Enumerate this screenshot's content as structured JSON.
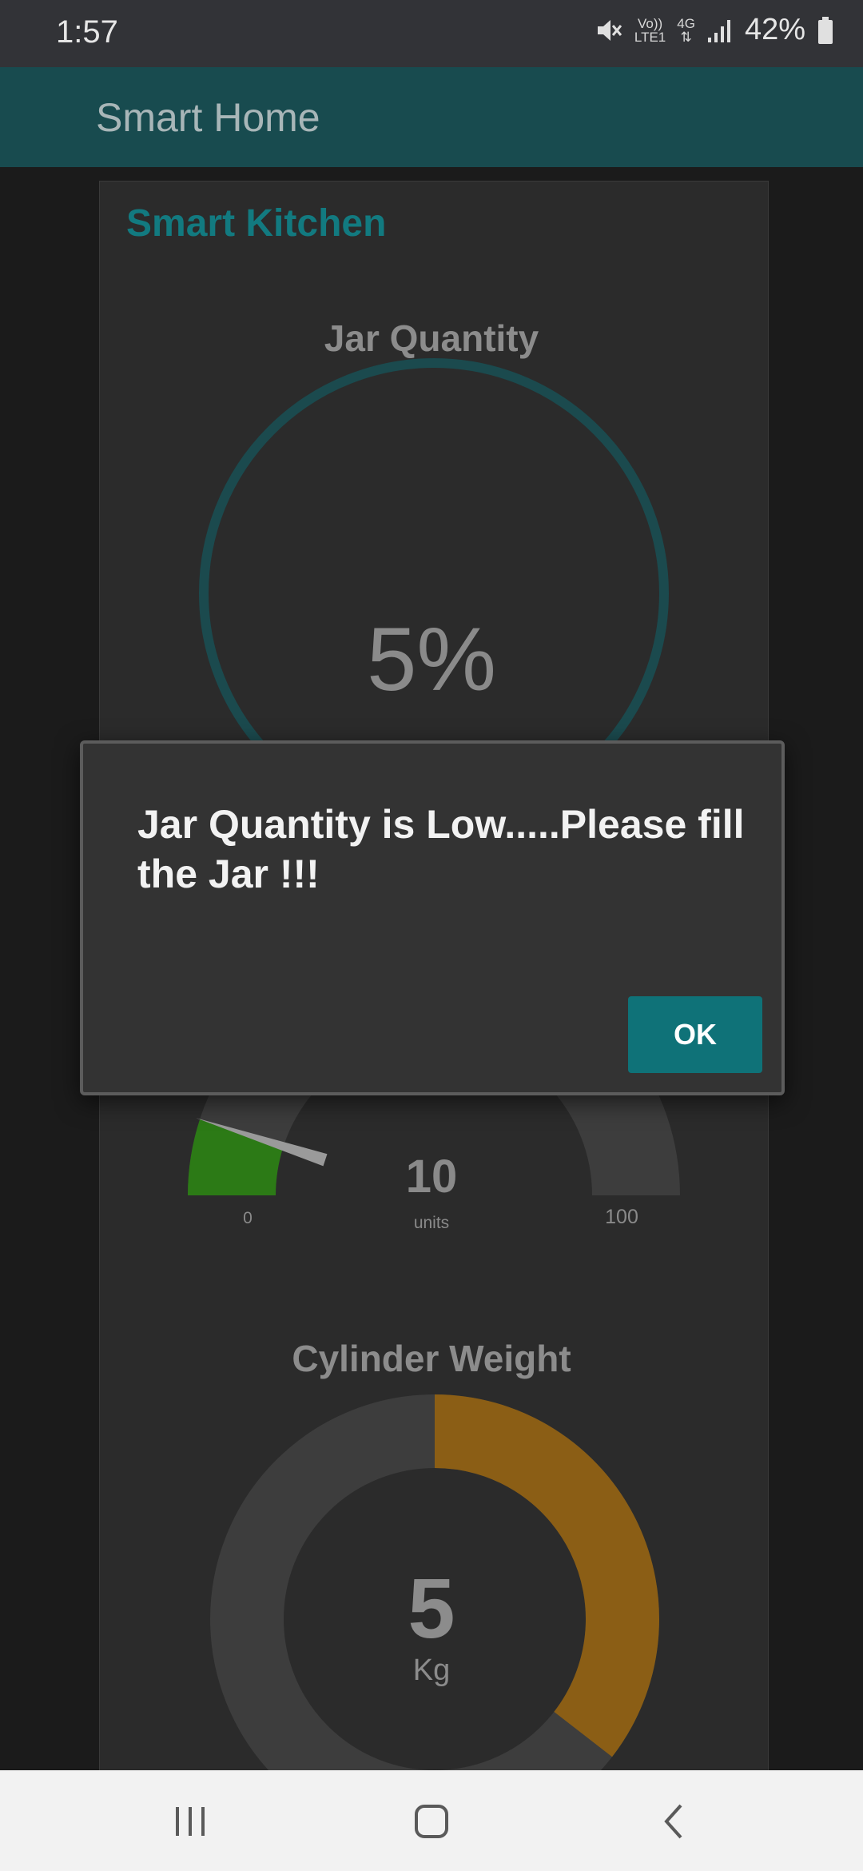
{
  "status_bar": {
    "time": "1:57",
    "network_label_top": "Vo))",
    "network_label_bottom": "LTE1",
    "network_type": "4G",
    "battery": "42%",
    "icons": [
      "mute-icon",
      "signal-icon",
      "battery-icon"
    ]
  },
  "app_bar": {
    "title": "Smart Home"
  },
  "card": {
    "title": "Smart Kitchen"
  },
  "jar_gauge": {
    "title": "Jar Quantity",
    "value_text": "5%",
    "value_fraction": 0.05,
    "ring_color": "#1b4a4e"
  },
  "units_gauge": {
    "value": "10",
    "unit": "units",
    "min_label": "0",
    "max_label": "100",
    "value_fraction": 0.1,
    "fill_color": "#2c7a16"
  },
  "cylinder_gauge": {
    "title": "Cylinder Weight",
    "value": "5",
    "unit": "Kg",
    "fill_color": "#8b5e15",
    "track_color": "#3d3d3d"
  },
  "dialog": {
    "message": "Jar Quantity is Low.....Please fill the Jar !!!",
    "ok_label": "OK",
    "accent": "#0f7278"
  },
  "nav_bar": {
    "icons": [
      "recent-apps-icon",
      "home-icon",
      "back-icon"
    ]
  }
}
